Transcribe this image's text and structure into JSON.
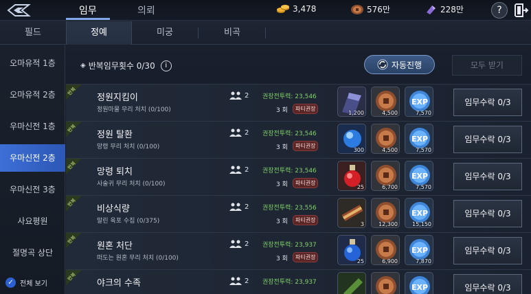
{
  "top": {
    "tabs": [
      {
        "label": "임무"
      },
      {
        "label": "의뢰"
      }
    ],
    "currencies": [
      {
        "icon": "gold-coins-icon",
        "value": "3,478",
        "color": "#f2b233"
      },
      {
        "icon": "bronze-coin-icon",
        "value": "576만",
        "color": "#c77a4a"
      },
      {
        "icon": "purple-crystal-icon",
        "value": "228만",
        "color": "#8a6bd6"
      }
    ]
  },
  "subtabs": [
    {
      "label": "필드"
    },
    {
      "label": "정예"
    },
    {
      "label": "미궁"
    },
    {
      "label": "비곡"
    }
  ],
  "sidebar": {
    "items": [
      {
        "label": "오마유적 1층"
      },
      {
        "label": "오마유적 2층"
      },
      {
        "label": "우마신전 1층"
      },
      {
        "label": "우마신전 2층"
      },
      {
        "label": "우마신전 3층"
      },
      {
        "label": "사요평원"
      },
      {
        "label": "절명곡 상단"
      }
    ],
    "view_all": "전체 보기"
  },
  "header": {
    "repeat_count": "반복임무횟수 0/30",
    "auto_button": "자동진행",
    "receive_all": "모두 받기"
  },
  "quests": [
    {
      "ribbon": "반복",
      "title": "정원지킴이",
      "sub": "정원마물 무리 처치 (0/100)",
      "party": "2",
      "power": "권장전투력: 23,546",
      "times": "3 회",
      "tag": "파티권장",
      "rewards": [
        {
          "icon": "scroll-item-icon",
          "qty": "1,200"
        },
        {
          "icon": "bronze-coin-icon",
          "qty": "4,500"
        },
        {
          "icon": "exp-orb-icon",
          "qty": "7,570"
        }
      ],
      "accept": "임무수락 0/3"
    },
    {
      "ribbon": "반복",
      "title": "정원 탈환",
      "sub": "망령 무리 처치 (0/100)",
      "party": "2",
      "power": "권장전투력: 23,546",
      "times": "3 회",
      "tag": "파티권장",
      "rewards": [
        {
          "icon": "blue-orb-icon",
          "qty": "300"
        },
        {
          "icon": "bronze-coin-icon",
          "qty": "4,500"
        },
        {
          "icon": "exp-orb-icon",
          "qty": "7,570"
        }
      ],
      "accept": "임무수락 0/3"
    },
    {
      "ribbon": "반복",
      "title": "망령 퇴치",
      "sub": "사술귀 무리 처치 (0/100)",
      "party": "2",
      "power": "권장전투력: 23,546",
      "times": "3 회",
      "tag": "파티권장",
      "rewards": [
        {
          "icon": "red-potion-icon",
          "qty": "25"
        },
        {
          "icon": "bronze-coin-icon",
          "qty": "6,700"
        },
        {
          "icon": "exp-orb-icon",
          "qty": "7,570"
        }
      ],
      "accept": "임무수락 0/3"
    },
    {
      "ribbon": "반복",
      "title": "비상식량",
      "sub": "말린 육포 수집 (0/375)",
      "party": "2",
      "power": "권장전투력: 23,556",
      "times": "3 회",
      "tag": "파티권장",
      "rewards": [
        {
          "icon": "bundle-item-icon",
          "qty": "3"
        },
        {
          "icon": "bronze-coin-icon",
          "qty": "12,300"
        },
        {
          "icon": "exp-orb-icon",
          "qty": "15,150"
        }
      ],
      "accept": "임무수락 0/3"
    },
    {
      "ribbon": "반복",
      "title": "원혼 처단",
      "sub": "떠도는 원혼 무리 처치 (0/100)",
      "party": "2",
      "power": "권장전투력: 23,937",
      "times": "3 회",
      "tag": "파티권장",
      "rewards": [
        {
          "icon": "blue-potion-icon",
          "qty": "25"
        },
        {
          "icon": "bronze-coin-icon",
          "qty": "6,900"
        },
        {
          "icon": "exp-orb-icon",
          "qty": "7,870"
        }
      ],
      "accept": "임무수락 0/3"
    },
    {
      "ribbon": "반복",
      "title": "야크의 수족",
      "sub": "",
      "party": "2",
      "power": "권장전투력: 23,937",
      "times": "",
      "tag": "",
      "rewards": [
        {
          "icon": "green-item-icon",
          "qty": ""
        },
        {
          "icon": "bronze-coin-icon",
          "qty": ""
        },
        {
          "icon": "exp-orb-icon",
          "qty": ""
        }
      ],
      "accept": "임무수락 0/3"
    }
  ]
}
